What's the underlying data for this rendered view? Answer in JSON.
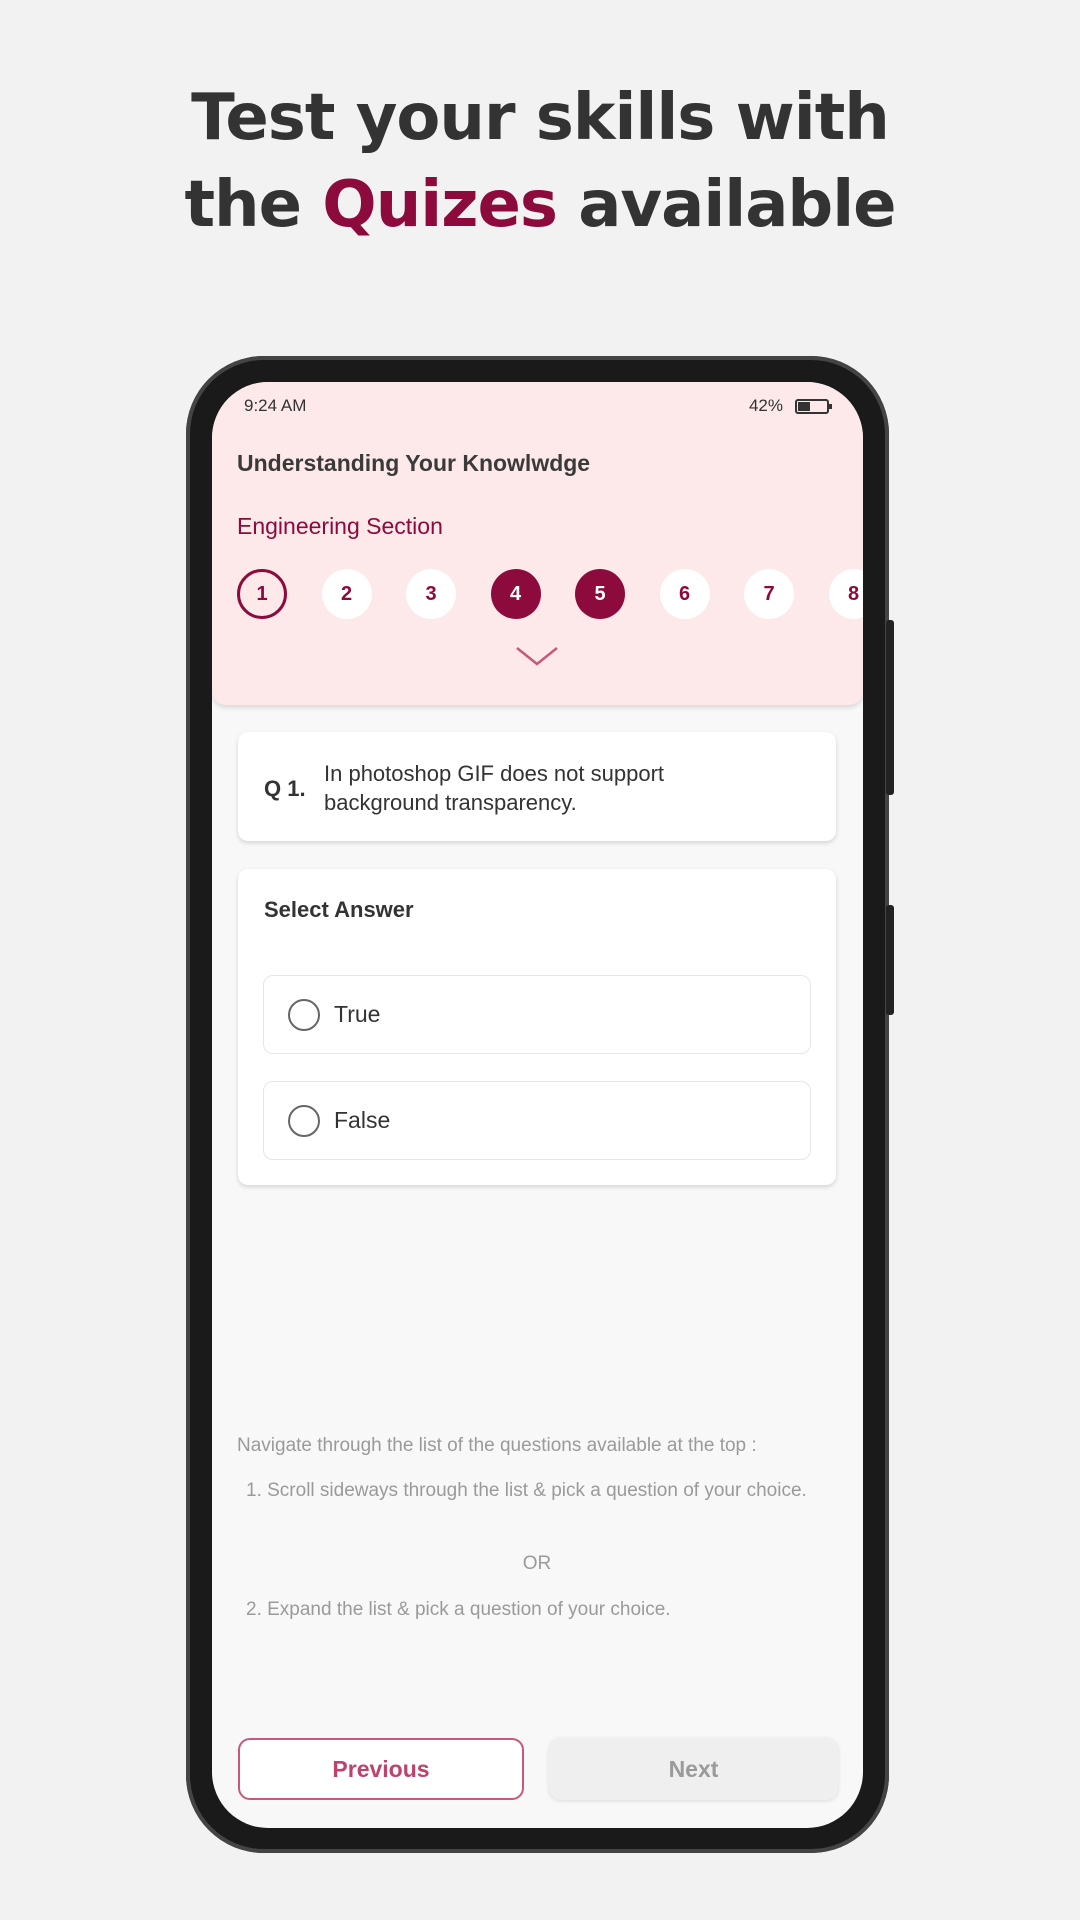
{
  "headline": {
    "line1": "Test your skills with",
    "line2_pre": "the ",
    "line2_accent": "Quizes",
    "line2_post": " available"
  },
  "colors": {
    "accent": "#8c0a3c",
    "header_bg": "#fde9e9",
    "button_border": "#c9587c"
  },
  "status_bar": {
    "time": "9:24 AM",
    "battery": "42%"
  },
  "quiz": {
    "title": "Understanding Your Knowlwdge",
    "section": "Engineering Section",
    "questions": [
      {
        "label": "1",
        "state": "current"
      },
      {
        "label": "2",
        "state": "unanswered"
      },
      {
        "label": "3",
        "state": "unanswered"
      },
      {
        "label": "4",
        "state": "answered"
      },
      {
        "label": "5",
        "state": "answered"
      },
      {
        "label": "6",
        "state": "unanswered"
      },
      {
        "label": "7",
        "state": "unanswered"
      },
      {
        "label": "8",
        "state": "unanswered"
      }
    ],
    "expand_icon": "chevron-down-icon"
  },
  "question": {
    "number": "Q 1.",
    "text": "In photoshop GIF does not support background transparency."
  },
  "answers": {
    "heading": "Select Answer",
    "options": [
      {
        "label": "True",
        "selected": false
      },
      {
        "label": "False",
        "selected": false
      }
    ]
  },
  "instructions": {
    "intro": "Navigate through the list of the questions available at the top :",
    "step1": "1. Scroll sideways through the list & pick a question of your choice.",
    "or": "OR",
    "step2": "2. Expand the list & pick a question of your choice."
  },
  "nav": {
    "previous": "Previous",
    "next": "Next",
    "next_enabled": false
  }
}
